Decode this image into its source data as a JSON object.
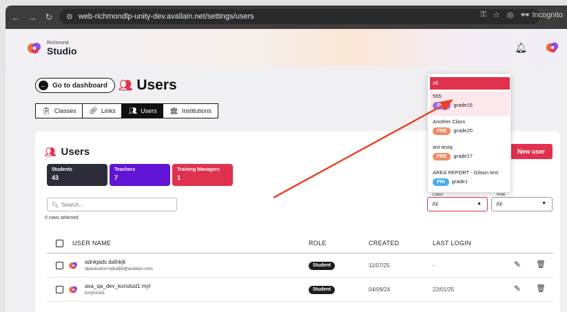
{
  "browser": {
    "url": "web-richmondlp-unity-dev.avallain.net/settings/users",
    "incognito_label": "Incognito"
  },
  "header": {
    "brand_small": "Richmond",
    "brand_big": "Studio"
  },
  "page": {
    "go_dashboard": "Go to dashboard",
    "title": "Users",
    "tabs": [
      {
        "label": "Classes",
        "icon": "clipboard-icon",
        "active": false
      },
      {
        "label": "Links",
        "icon": "link-icon",
        "active": false
      },
      {
        "label": "Users",
        "icon": "users-icon",
        "active": true
      },
      {
        "label": "Institutions",
        "icon": "institution-icon",
        "active": false
      }
    ]
  },
  "card": {
    "title": "Users",
    "new_user": "New user",
    "stats": [
      {
        "label": "Students",
        "value": "43"
      },
      {
        "label": "Teachers",
        "value": "7"
      },
      {
        "label": "Training Managers",
        "value": "1"
      }
    ],
    "search_placeholder": "Search...",
    "rows_selected": "0 rows selected",
    "filters": {
      "class_label": "Class",
      "class_value": "All",
      "role_label": "Role",
      "role_value": "All"
    },
    "columns": [
      "USER NAME",
      "ROLE",
      "CREATED",
      "LAST LOGIN"
    ],
    "rows": [
      {
        "name": "adnkjads dafnkjk",
        "email": "dpankratov+kjbafjlb@avallain.com",
        "role": "Student",
        "created": "11/07/25",
        "last_login": "-"
      },
      {
        "name": "ava_qa_dev_konstud1 myl",
        "email": "kmylstud1",
        "role": "Student",
        "created": "04/09/24",
        "last_login": "22/01/25"
      }
    ]
  },
  "dropdown": {
    "all_label": "All",
    "items": [
      {
        "name": "555",
        "tag": "SEC",
        "tag_color": "#9b6fd9",
        "grade": "grade16",
        "highlighted": true
      },
      {
        "name": "Another Class",
        "tag": "PRE",
        "tag_color": "#f08a66",
        "grade": "grade20",
        "highlighted": false
      },
      {
        "name": "ant testq",
        "tag": "PRE",
        "tag_color": "#f08a66",
        "grade": "grade17",
        "highlighted": false
      },
      {
        "name": "AREA REPORT - Gilson test",
        "tag": "PRI",
        "tag_color": "#45aee8",
        "grade": "grade1",
        "highlighted": false
      }
    ]
  },
  "colors": {
    "accent": "#e0314e",
    "teachers": "#6114d6",
    "students": "#2d2d3a",
    "annotation_arrow": "#e8432a"
  }
}
